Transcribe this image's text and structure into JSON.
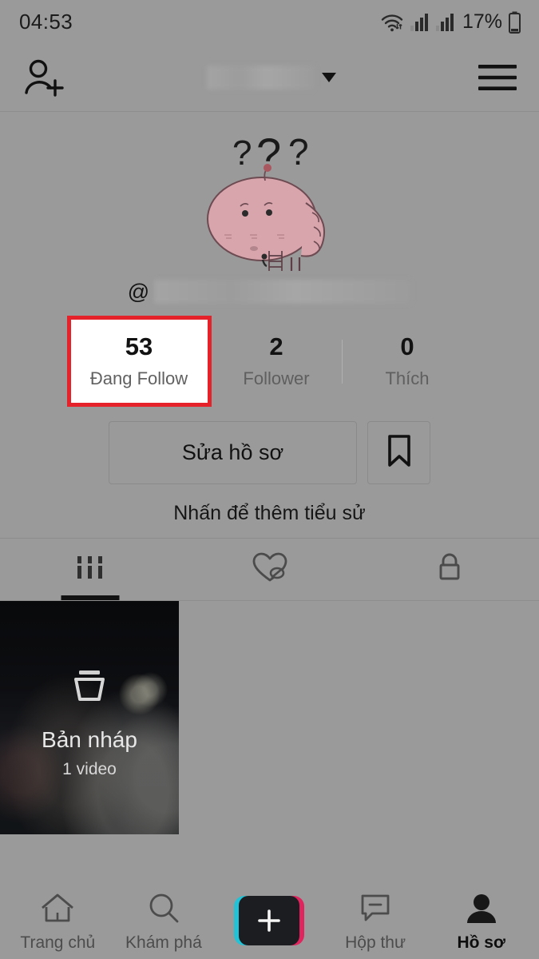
{
  "status_bar": {
    "time": "04:53",
    "battery_percent": "17%",
    "wifi_icon": "wifi-icon",
    "signal_icon_1": "signal-bars-icon",
    "signal_icon_2": "signal-bars-icon",
    "battery_icon": "battery-icon"
  },
  "header": {
    "add_friend_icon": "person-add-icon",
    "title": "",
    "title_redacted": true,
    "dropdown_icon": "chevron-down-icon",
    "menu_icon": "hamburger-menu-icon"
  },
  "profile": {
    "avatar_icon": "cartoon-blob-avatar",
    "avatar_question_marks": "???",
    "at_symbol": "@",
    "username": "",
    "username_redacted": true,
    "stats": [
      {
        "value": "53",
        "label": "Đang Follow",
        "highlighted": true
      },
      {
        "value": "2",
        "label": "Follower",
        "highlighted": false
      },
      {
        "value": "0",
        "label": "Thích",
        "highlighted": false
      }
    ],
    "edit_profile_label": "Sửa hồ sơ",
    "bookmark_icon": "bookmark-icon",
    "bio_hint": "Nhấn để thêm tiểu sử"
  },
  "content_tabs": [
    {
      "icon": "grid-posts-icon",
      "active": true
    },
    {
      "icon": "heart-hidden-icon",
      "active": false
    },
    {
      "icon": "lock-icon",
      "active": false
    }
  ],
  "drafts": {
    "icon": "drafts-stack-icon",
    "title": "Bản nháp",
    "count_label": "1 video"
  },
  "bottom_nav": [
    {
      "label": "Trang chủ",
      "icon": "home-icon",
      "active": false
    },
    {
      "label": "Khám phá",
      "icon": "search-icon",
      "active": false
    },
    {
      "label": "",
      "icon": "create-plus-icon",
      "active": false
    },
    {
      "label": "Hộp thư",
      "icon": "inbox-message-icon",
      "active": false
    },
    {
      "label": "Hồ sơ",
      "icon": "profile-person-icon",
      "active": true
    }
  ],
  "colors": {
    "background": "#9a9a9a",
    "highlight_border": "#e5222a",
    "highlight_fill": "#ffffff",
    "text_primary": "#121212",
    "text_secondary": "#5f5f5f",
    "accent_cyan": "#22c3d6",
    "accent_pink": "#e0245e"
  }
}
